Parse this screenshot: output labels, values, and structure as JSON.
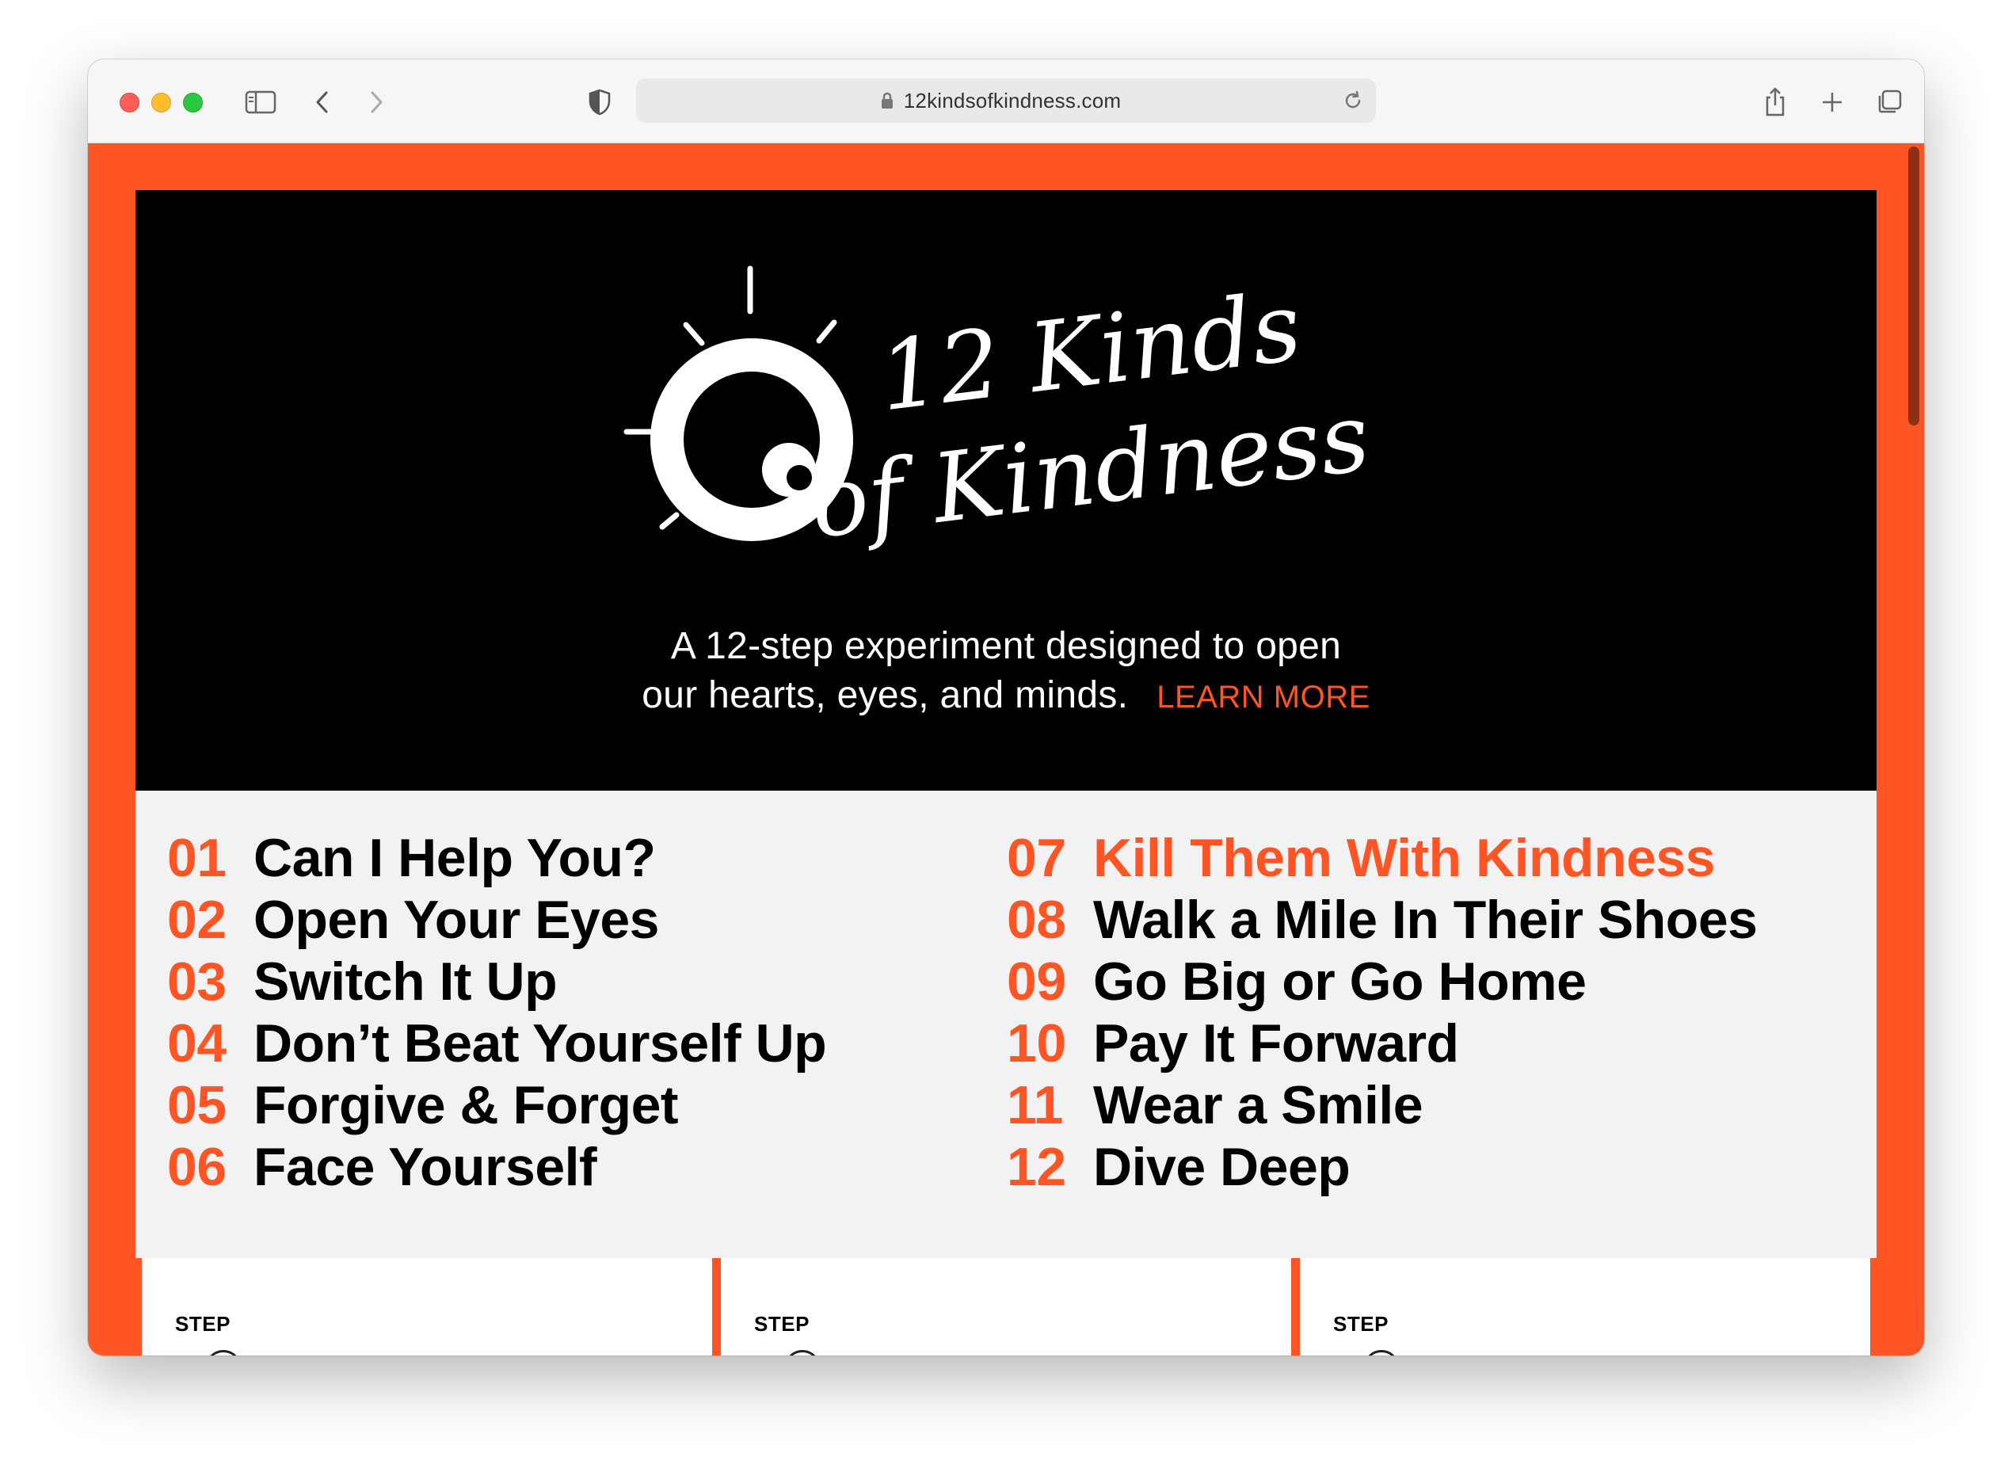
{
  "browser": {
    "url": "12kindsofkindness.com"
  },
  "hero": {
    "logo_text": [
      "12 Kinds",
      "of Kindness"
    ],
    "tagline_line1": "A 12-step experiment designed to open",
    "tagline_line2": "our hearts, eyes, and minds.",
    "learn_more": "LEARN MORE"
  },
  "steps": {
    "left": [
      {
        "num": "01",
        "title": "Can I Help You?"
      },
      {
        "num": "02",
        "title": "Open Your Eyes"
      },
      {
        "num": "03",
        "title": "Switch It Up"
      },
      {
        "num": "04",
        "title": "Don’t Beat Yourself Up"
      },
      {
        "num": "05",
        "title": "Forgive & Forget"
      },
      {
        "num": "06",
        "title": "Face Yourself"
      }
    ],
    "right": [
      {
        "num": "07",
        "title": "Kill Them With Kindness"
      },
      {
        "num": "08",
        "title": "Walk a Mile In Their Shoes"
      },
      {
        "num": "09",
        "title": "Go Big or Go Home"
      },
      {
        "num": "10",
        "title": "Pay It Forward"
      },
      {
        "num": "11",
        "title": "Wear a Smile"
      },
      {
        "num": "12",
        "title": "Dive Deep"
      }
    ]
  },
  "cards": [
    {
      "label": "STEP"
    },
    {
      "label": "STEP"
    },
    {
      "label": "STEP"
    }
  ],
  "colors": {
    "accent": "#ff5524",
    "hero_bg": "#000000",
    "steps_bg": "#f2f2f2"
  }
}
